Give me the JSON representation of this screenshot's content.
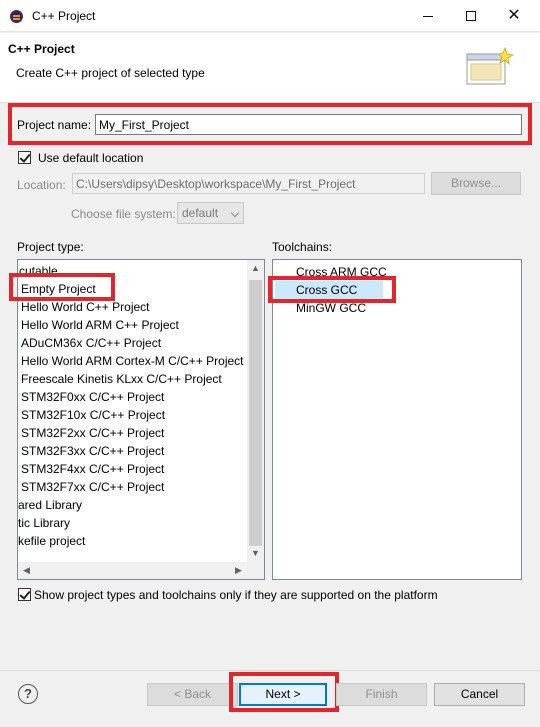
{
  "window": {
    "title": "C++ Project"
  },
  "header": {
    "title": "C++ Project",
    "description": "Create C++ project of selected type"
  },
  "project_name": {
    "label": "Project name:",
    "value": "My_First_Project"
  },
  "location": {
    "use_default_label": "Use default location",
    "use_default_checked": true,
    "label": "Location:",
    "value": "C:\\Users\\dipsy\\Desktop\\workspace\\My_First_Project",
    "browse_label": "Browse...",
    "filesystem_label": "Choose file system:",
    "filesystem_value": "default"
  },
  "project_type": {
    "label": "Project type:",
    "items": [
      "cutable",
      "Empty Project",
      "Hello World C++ Project",
      "Hello World ARM C++ Project",
      "ADuCM36x C/C++ Project",
      "Hello World ARM Cortex-M C/C++ Project",
      "Freescale Kinetis KLxx C/C++ Project",
      "STM32F0xx C/C++ Project",
      "STM32F10x C/C++ Project",
      "STM32F2xx C/C++ Project",
      "STM32F3xx C/C++ Project",
      "STM32F4xx C/C++ Project",
      "STM32F7xx C/C++ Project",
      "ared Library",
      "tic Library",
      "kefile project"
    ],
    "selected": "Empty Project"
  },
  "toolchains": {
    "label": "Toolchains:",
    "items": [
      "Cross ARM GCC",
      "Cross GCC",
      "MinGW GCC"
    ],
    "selected": "Cross GCC"
  },
  "filter": {
    "label": "Show project types and toolchains only if they are supported on the platform",
    "checked": true
  },
  "buttons": {
    "back": "< Back",
    "next": "Next >",
    "finish": "Finish",
    "cancel": "Cancel"
  },
  "colors": {
    "highlight": "#e3262e",
    "selection": "#cce8ff"
  }
}
